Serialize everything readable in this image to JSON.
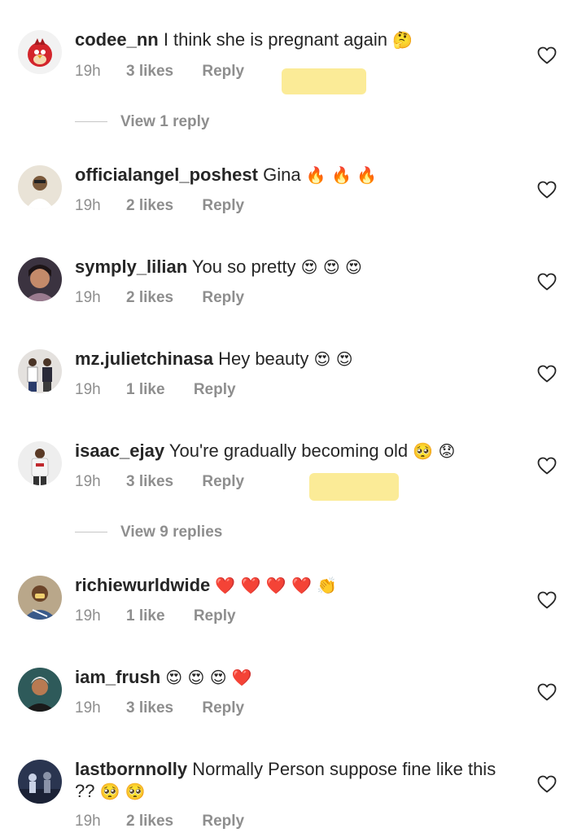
{
  "comments": [
    {
      "user": "codee_nn",
      "text": "I think she is pregnant again",
      "emoji": "🤔",
      "time": "19h",
      "likes": "3 likes",
      "reply": "Reply"
    },
    {
      "user": "officialangel_poshest",
      "text": "Gina",
      "emoji": "🔥 🔥 🔥",
      "time": "19h",
      "likes": "2 likes",
      "reply": "Reply"
    },
    {
      "user": "symply_lilian",
      "text": "You so pretty",
      "emoji": "😍 😍 😍",
      "time": "19h",
      "likes": "2 likes",
      "reply": "Reply"
    },
    {
      "user": "mz.julietchinasa",
      "text": "Hey beauty",
      "emoji": "😍 😍",
      "time": "19h",
      "likes": "1 like",
      "reply": "Reply"
    },
    {
      "user": "isaac_ejay",
      "text": "You're gradually becoming old",
      "emoji": "🥺 😟",
      "time": "19h",
      "likes": "3 likes",
      "reply": "Reply"
    },
    {
      "user": "richiewurldwide",
      "text": "",
      "emoji": "❤️ ❤️ ❤️ ❤️ 👏",
      "time": "19h",
      "likes": "1 like",
      "reply": "Reply"
    },
    {
      "user": "iam_frush",
      "text": "",
      "emoji": "😍 😍 😍 ❤️",
      "time": "19h",
      "likes": "3 likes",
      "reply": "Reply"
    },
    {
      "user": "lastbornnolly",
      "text": "Normally Person suppose fine like this ??",
      "emoji": "🥺 🥺",
      "time": "19h",
      "likes": "2 likes",
      "reply": "Reply"
    }
  ],
  "view_replies": [
    "View 1 reply",
    "View 9 replies"
  ],
  "icons": {
    "like": "heart-outline-icon"
  },
  "colors": {
    "text": "#262626",
    "meta": "#8e8e8e",
    "highlight": "#fbe98c"
  }
}
